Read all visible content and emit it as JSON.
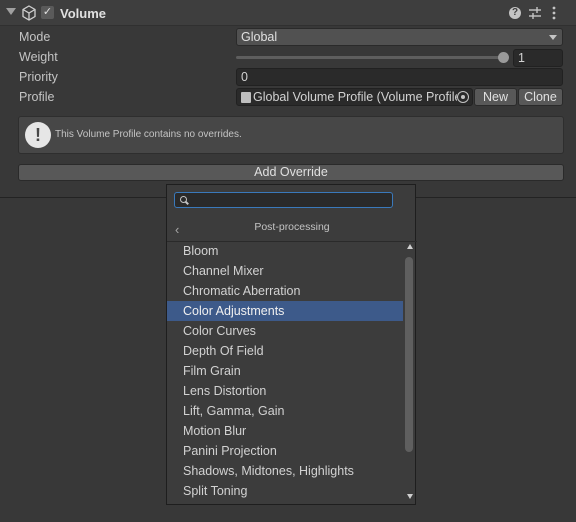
{
  "header": {
    "title": "Volume",
    "help_glyph": "?",
    "check_glyph": "✓"
  },
  "fields": {
    "mode": {
      "label": "Mode",
      "value": "Global"
    },
    "weight": {
      "label": "Weight",
      "value": "1",
      "slider_fraction": 1.0
    },
    "priority": {
      "label": "Priority",
      "value": "0"
    },
    "profile": {
      "label": "Profile",
      "value": "Global Volume Profile (Volume Profile)",
      "new_label": "New",
      "clone_label": "Clone"
    }
  },
  "help_box": {
    "icon_glyph": "!",
    "text": "This Volume Profile contains no overrides."
  },
  "add_override": {
    "label": "Add Override"
  },
  "popup": {
    "search_value": "",
    "title": "Post-processing",
    "back_glyph": "‹",
    "selected_index": 3,
    "items": [
      "Bloom",
      "Channel Mixer",
      "Chromatic Aberration",
      "Color Adjustments",
      "Color Curves",
      "Depth Of Field",
      "Film Grain",
      "Lens Distortion",
      "Lift, Gamma, Gain",
      "Motion Blur",
      "Panini Projection",
      "Shadows, Midtones, Highlights",
      "Split Toning"
    ]
  },
  "colors": {
    "selection": "#3d5a8a",
    "search_focus": "#3a79bb",
    "background": "#383838"
  }
}
